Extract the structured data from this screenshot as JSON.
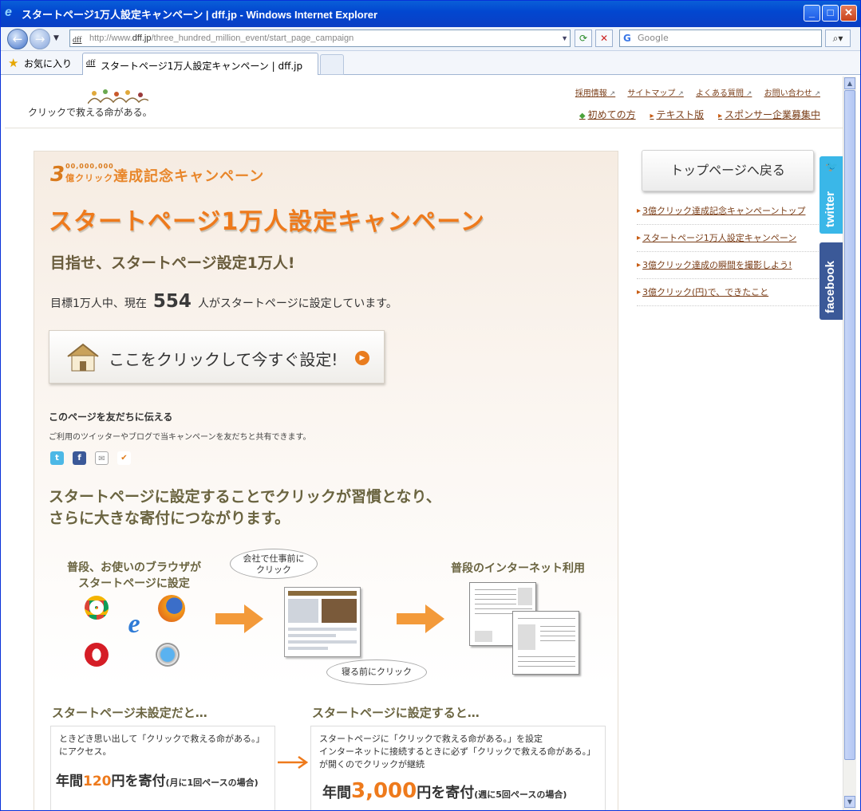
{
  "window": {
    "title": "スタートページ1万人設定キャンペーン | dff.jp - Windows Internet Explorer"
  },
  "nav": {
    "url_prefix": "http://www.",
    "url_domain": "dff.jp",
    "url_path": "/three_hundred_million_event/start_page_campaign",
    "url_favicon": "dff",
    "search_placeholder": "Google"
  },
  "favorites": {
    "label": "お気に入り"
  },
  "tab": {
    "favicon": "dff",
    "label": "スタートページ1万人設定キャンペーン | dff.jp"
  },
  "header": {
    "logo_text": "クリックで救える命がある。",
    "top_links": [
      "採用情報",
      "サイトマップ",
      "よくある質問",
      "お問い合わせ"
    ],
    "sub_links": [
      "初めての方",
      "テキスト版",
      "スポンサー企業募集中"
    ]
  },
  "campaign": {
    "badge_number": "3",
    "badge_zeros": "00,000,000",
    "badge_unit": "億クリック",
    "badge_text": "達成記念キャンペーン",
    "title": "スタートページ1万人設定キャンペーン",
    "subtitle": "目指せ、スタートページ設定1万人!",
    "count_prefix": "目標1万人中、現在",
    "count": "554",
    "count_suffix": "人がスタートページに設定しています。",
    "cta_label": "ここをクリックして今すぐ設定!",
    "share_heading": "このページを友だちに伝える",
    "share_text": "ご利用のツイッターやブログで当キャンペーンを友だちと共有できます。",
    "lead_line1": "スタートページに設定することでクリックが習慣となり、",
    "lead_line2": "さらに大きな寄付につながります。",
    "diagram_label_a1": "普段、お使いのブラウザが",
    "diagram_label_a2": "スタートページに設定",
    "bubble_work1": "会社で仕事前に",
    "bubble_work2": "クリック",
    "bubble_sleep": "寝る前にクリック",
    "diagram_label_b": "普段のインターネット利用",
    "before_heading": "スタートページ未設定だと…",
    "before_text1": "ときどき思い出して「クリックで救える命がある。」",
    "before_text2": "にアクセス。",
    "before_prefix": "年間",
    "before_amount": "120",
    "before_suffix": "円を寄付",
    "before_note": "(月に1回ペースの場合)",
    "after_heading": "スタートページに設定すると…",
    "after_text1": "スタートページに「クリックで救える命がある。」を設定",
    "after_text2": "インターネットに接続するときに必ず「クリックで救える命がある。」",
    "after_text3": "が開くのでクリックが継続",
    "after_prefix": "年間",
    "after_amount": "3,000",
    "after_suffix": "円を寄付",
    "after_note": "(週に5回ペースの場合)"
  },
  "sidebar": {
    "top_button": "トップページへ戻る",
    "links": [
      "3億クリック達成記念キャンペーントップ",
      "スタートページ1万人設定キャンペーン",
      "3億クリック達成の瞬間を撮影しよう!",
      "3億クリック(円)で、できたこと"
    ],
    "twitter": "twitter",
    "facebook": "facebook"
  },
  "colors": {
    "accent": "#ee7a1c",
    "heading": "#6a6440",
    "link": "#7a3d17"
  }
}
